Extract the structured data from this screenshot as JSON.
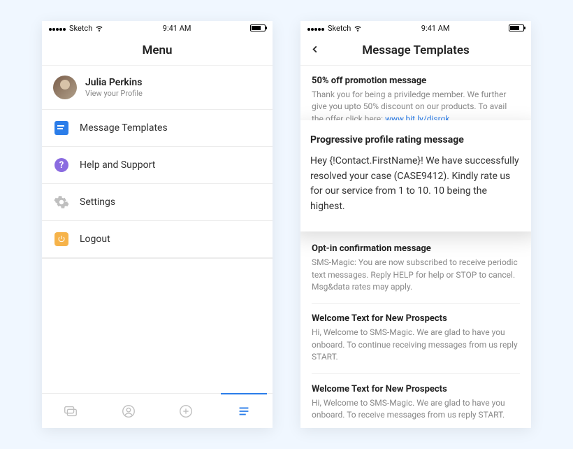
{
  "statusbar": {
    "carrier": "Sketch",
    "time": "9:41 AM"
  },
  "menu_screen": {
    "title": "Menu",
    "profile": {
      "name": "Julia Perkins",
      "subtitle": "View your Profile"
    },
    "items": [
      {
        "id": "templates",
        "label": "Message Templates"
      },
      {
        "id": "help",
        "label": "Help and Support"
      },
      {
        "id": "settings",
        "label": "Settings"
      },
      {
        "id": "logout",
        "label": "Logout"
      }
    ]
  },
  "templates_screen": {
    "title": "Message Templates",
    "templates": [
      {
        "title": "50% off promotion message",
        "body": "Thank you for being a priviledge member. We further give you upto 50% discount on our products. To avail the offer click here: ",
        "link": "www.bit.ly/djsrgk"
      },
      {
        "title": "Progressive profile rating message",
        "body": "Hey {!Contact.FirstName}! We have successfully resolved your case (CASE9412). Kindly rate us for our service from 1 to 10. 10 being the highest."
      },
      {
        "title": "Opt-in confirmation message",
        "body": "SMS-Magic: You are now subscribed to receive periodic text messages. Reply HELP for help or STOP to cancel. Msg&data rates may apply."
      },
      {
        "title": "Welcome Text for New Prospects",
        "body": "Hi, Welcome to SMS-Magic. We are glad to have you onboard. To continue receiving messages from us reply START."
      },
      {
        "title": "Welcome Text for New Prospects",
        "body": "Hi, Welcome to SMS-Magic. We are glad to have you onboard. To receive messages from us reply START."
      }
    ],
    "selected_index": 1
  }
}
